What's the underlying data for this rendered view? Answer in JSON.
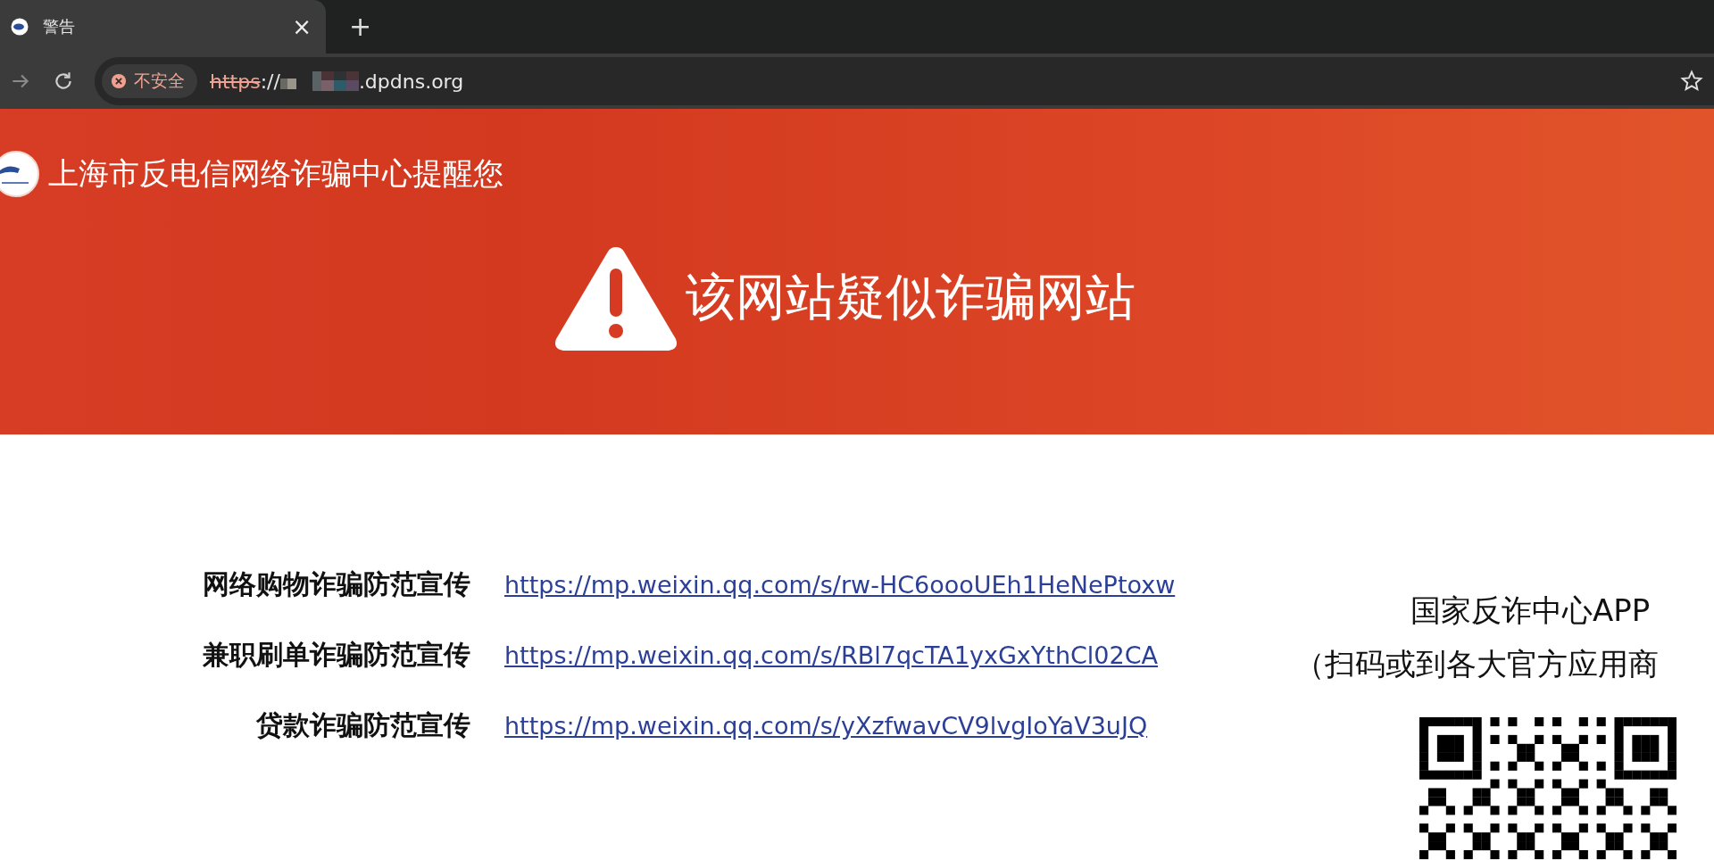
{
  "browser": {
    "tab": {
      "title": "警告",
      "close": "×",
      "new_tab": "+"
    },
    "address_bar": {
      "security_label": "不安全",
      "scheme": "https",
      "separator": "://",
      "domain": ".dpdns.org"
    }
  },
  "banner": {
    "org_heading": "上海市反电信网络诈骗中心提醒您",
    "warning_title": "该网站疑似诈骗网站"
  },
  "links": [
    {
      "label": "网络购物诈骗防范宣传",
      "url": "https://mp.weixin.qq.com/s/rw-HC6oooUEh1HeNePtoxw"
    },
    {
      "label": "兼职刷单诈骗防范宣传",
      "url": "https://mp.weixin.qq.com/s/RBl7qcTA1yxGxYthCl02CA"
    },
    {
      "label": "贷款诈骗防范宣传",
      "url": "https://mp.weixin.qq.com/s/yXzfwavCV9lvgIoYaV3uJQ"
    }
  ],
  "app_promo": {
    "title": "国家反诈中心APP",
    "note": "（扫码或到各大官方应用商"
  }
}
